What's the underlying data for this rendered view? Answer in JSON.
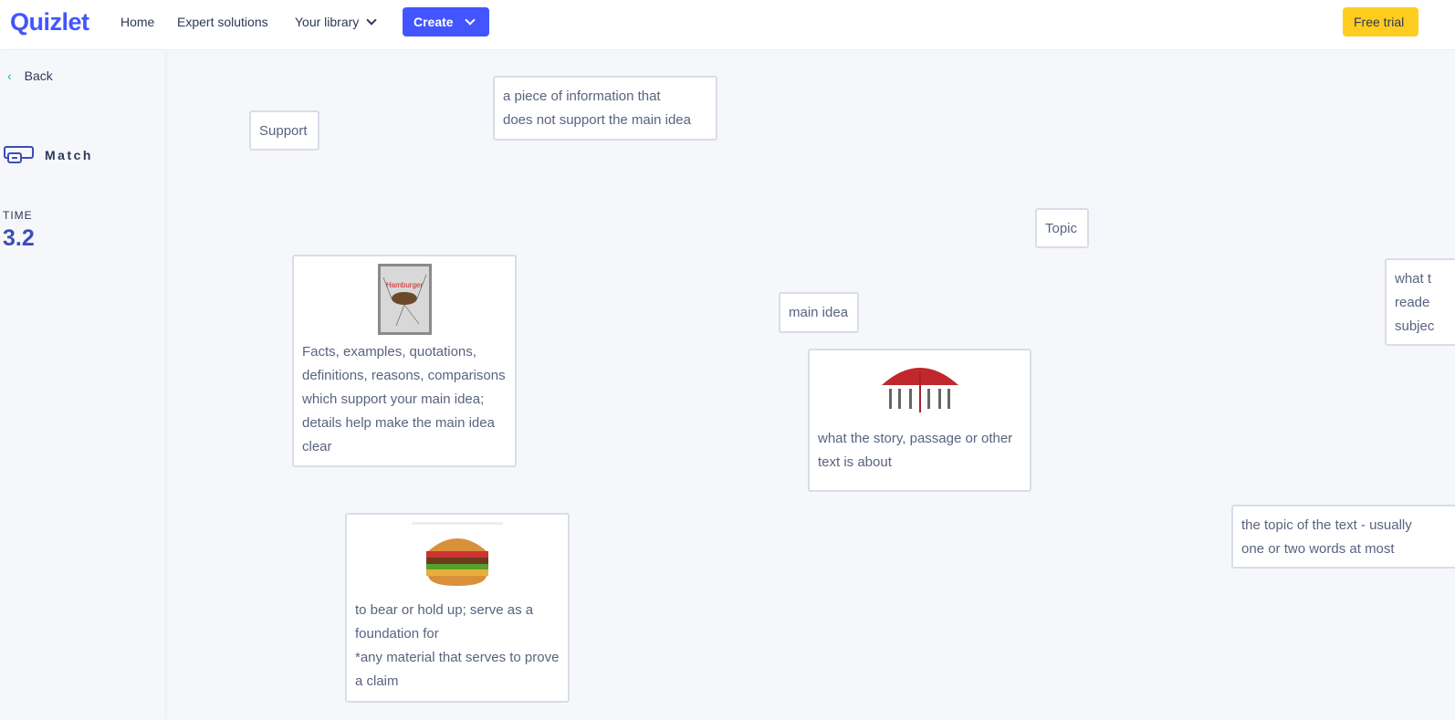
{
  "header": {
    "logo": "Quizlet",
    "nav": [
      "Home",
      "Expert solutions",
      "Your library"
    ],
    "create": "Create",
    "free_trial": "Free trial"
  },
  "sidebar": {
    "back": "Back",
    "mode": "Match",
    "time_label": "TIME",
    "time_value": "3.2"
  },
  "cards": [
    {
      "text": "Support"
    },
    {
      "text": "a piece of information that\ndoes not support the main idea"
    },
    {
      "text": "Topic"
    },
    {
      "text": "Facts, examples, quotations, definitions, reasons, comparisons which support your main idea; details help make the main idea clear",
      "image": "hamburger-diagram-image"
    },
    {
      "text": "main idea"
    },
    {
      "text": "what the story, passage or other text is about",
      "image": "umbrella-image"
    },
    {
      "text": "what t\nreade\nsubjec"
    },
    {
      "text": "the topic of the text - usually\none or two words at most"
    },
    {
      "text": "to bear or hold up; serve as a foundation for\n*any material that serves to prove a claim",
      "image": "hamburger-image"
    }
  ],
  "colors": {
    "brand": "#4255ff",
    "trial": "#ffcd1f",
    "time": "#3b4db8"
  }
}
